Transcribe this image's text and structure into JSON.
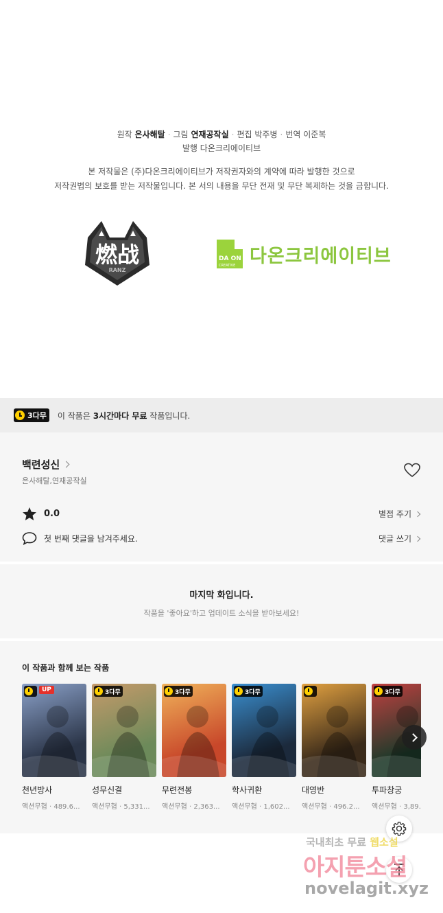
{
  "credits": {
    "original_label": "원작",
    "original_author": "은사해탈",
    "art_label": "그림",
    "art_author": "연재공작실",
    "editor_label": "편집",
    "editor": "박주병",
    "translator_label": "번역",
    "translator": "이준복",
    "publisher_label": "발행",
    "publisher": "다온크리에이티브"
  },
  "notice": {
    "line1": "본 저작물은 (주)다온크리에이티브가 저작권자와의 계약에 따라 발행한 것으로",
    "line2": "저작권법의 보호를 받는 저작물입니다. 본 서의 내용을 무단 전재 및 무단 복제하는 것을 금합니다."
  },
  "logos": {
    "ranz_text": "燃战",
    "ranz_sub": "RANZ",
    "daon_mark_top": "DA ON",
    "daon_mark_bottom": "CREATIVE",
    "daon_text": "다온크리에이티브"
  },
  "free_banner": {
    "badge": "3다무",
    "text_pre": "이 작품은 ",
    "text_bold": "3시간마다 무료",
    "text_post": " 작품입니다."
  },
  "work": {
    "title": "백련성신",
    "authors": "은사해탈,연재공작실",
    "rating": "0.0",
    "rate_link": "별점 주기",
    "comment_prompt": "첫 번째 댓글을 남겨주세요.",
    "comment_link": "댓글 쓰기"
  },
  "last_episode": {
    "title": "마지막 화입니다.",
    "subtitle": "작품을 '좋아요'하고 업데이트 소식을 받아보세요!"
  },
  "related": {
    "heading": "이 작품과 함께 보는 작품",
    "items": [
      {
        "title": "천년방사",
        "meta": "액션무협 · 489.6...",
        "badge": "",
        "up": "UP",
        "colors": [
          "#2b3548",
          "#8aa0c8"
        ]
      },
      {
        "title": "성무신결",
        "meta": "액션무협 · 5,331...",
        "badge": "3다무",
        "up": "",
        "colors": [
          "#6c8a5a",
          "#c59a6a"
        ]
      },
      {
        "title": "무련전봉",
        "meta": "액션무협 · 2,363...",
        "badge": "3다무",
        "up": "",
        "colors": [
          "#c8472a",
          "#f0b25a"
        ]
      },
      {
        "title": "학사귀환",
        "meta": "액션무협 · 1,602...",
        "badge": "3다무",
        "up": "",
        "colors": [
          "#1c2a3c",
          "#3a8fd0"
        ]
      },
      {
        "title": "대영반",
        "meta": "액션무협 · 496.2...",
        "badge": "",
        "up": "",
        "colors": [
          "#3a2a1a",
          "#e0a040"
        ]
      },
      {
        "title": "투파창궁",
        "meta": "액션무협 · 3,89...",
        "badge": "3다무",
        "up": "",
        "colors": [
          "#1e3a2a",
          "#c04040"
        ]
      }
    ]
  },
  "watermark": {
    "line1_a": "국내최초 무료 ",
    "line1_b": "웹소설",
    "line2": "아지툰소설",
    "line3": "novelagit.xyz"
  },
  "icons": {
    "heart": "heart-icon",
    "star": "star-icon",
    "comment": "comment-icon",
    "settings": "gear-icon",
    "scroll_top": "arrow-up-icon",
    "next": "chevron-right-icon"
  }
}
